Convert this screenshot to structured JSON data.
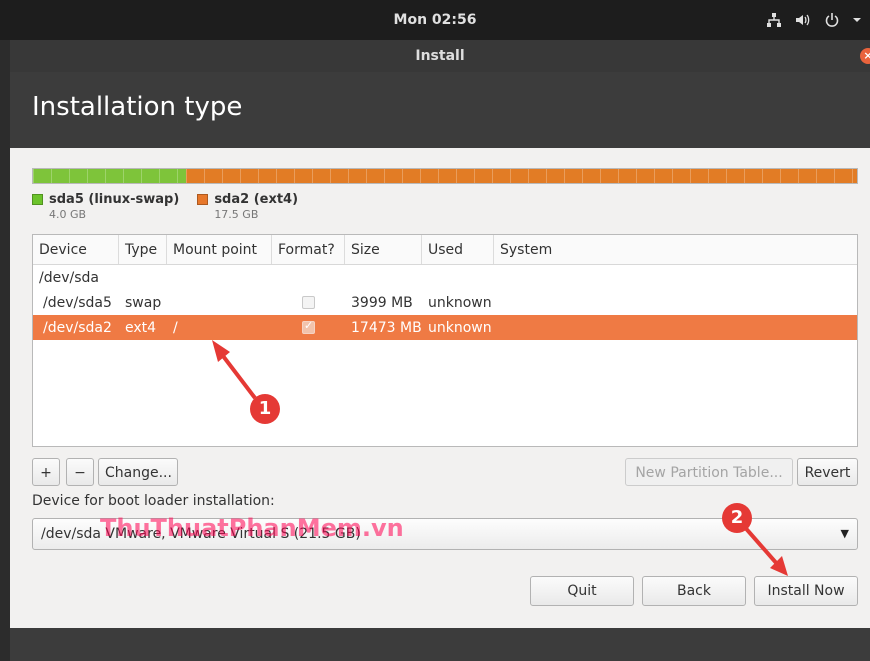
{
  "topbar": {
    "clock": "Mon 02:56"
  },
  "window": {
    "title": "Install",
    "close_glyph": "×"
  },
  "page": {
    "title": "Installation type"
  },
  "disk_bar": {
    "segments": [
      {
        "name": "sda5",
        "fraction": 0.186,
        "color": "#7ec43a"
      },
      {
        "name": "sda2",
        "fraction": 0.814,
        "color": "#e27c25"
      }
    ]
  },
  "legend": [
    {
      "label": "sda5 (linux-swap)",
      "size": "4.0 GB",
      "color": "#6cc32b"
    },
    {
      "label": "sda2 (ext4)",
      "size": "17.5 GB",
      "color": "#e7772a"
    }
  ],
  "table": {
    "columns": [
      "Device",
      "Type",
      "Mount point",
      "Format?",
      "Size",
      "Used",
      "System"
    ],
    "rows": [
      {
        "device": "/dev/sda",
        "type": "",
        "mount": "",
        "format": null,
        "size": "",
        "used": "",
        "system": ""
      },
      {
        "device": "/dev/sda5",
        "type": "swap",
        "mount": "",
        "format": false,
        "size": "3999 MB",
        "used": "unknown",
        "system": ""
      },
      {
        "device": "/dev/sda2",
        "type": "ext4",
        "mount": "/",
        "format": true,
        "size": "17473 MB",
        "used": "unknown",
        "system": "",
        "selected": true
      }
    ]
  },
  "buttons": {
    "add": "+",
    "remove": "−",
    "change": "Change...",
    "new_table": "New Partition Table...",
    "revert": "Revert",
    "quit": "Quit",
    "back": "Back",
    "install": "Install Now"
  },
  "boot": {
    "label": "Device for boot loader installation:",
    "selected": "/dev/sda   VMware, VMware Virtual S (21.5 GB)",
    "arrow": "▼"
  },
  "annotations": {
    "badge1": "1",
    "badge2": "2",
    "watermark": "ThuThuatPhanMem.vn"
  },
  "colors": {
    "accent": "#ef7a44",
    "badge": "#e53935"
  }
}
